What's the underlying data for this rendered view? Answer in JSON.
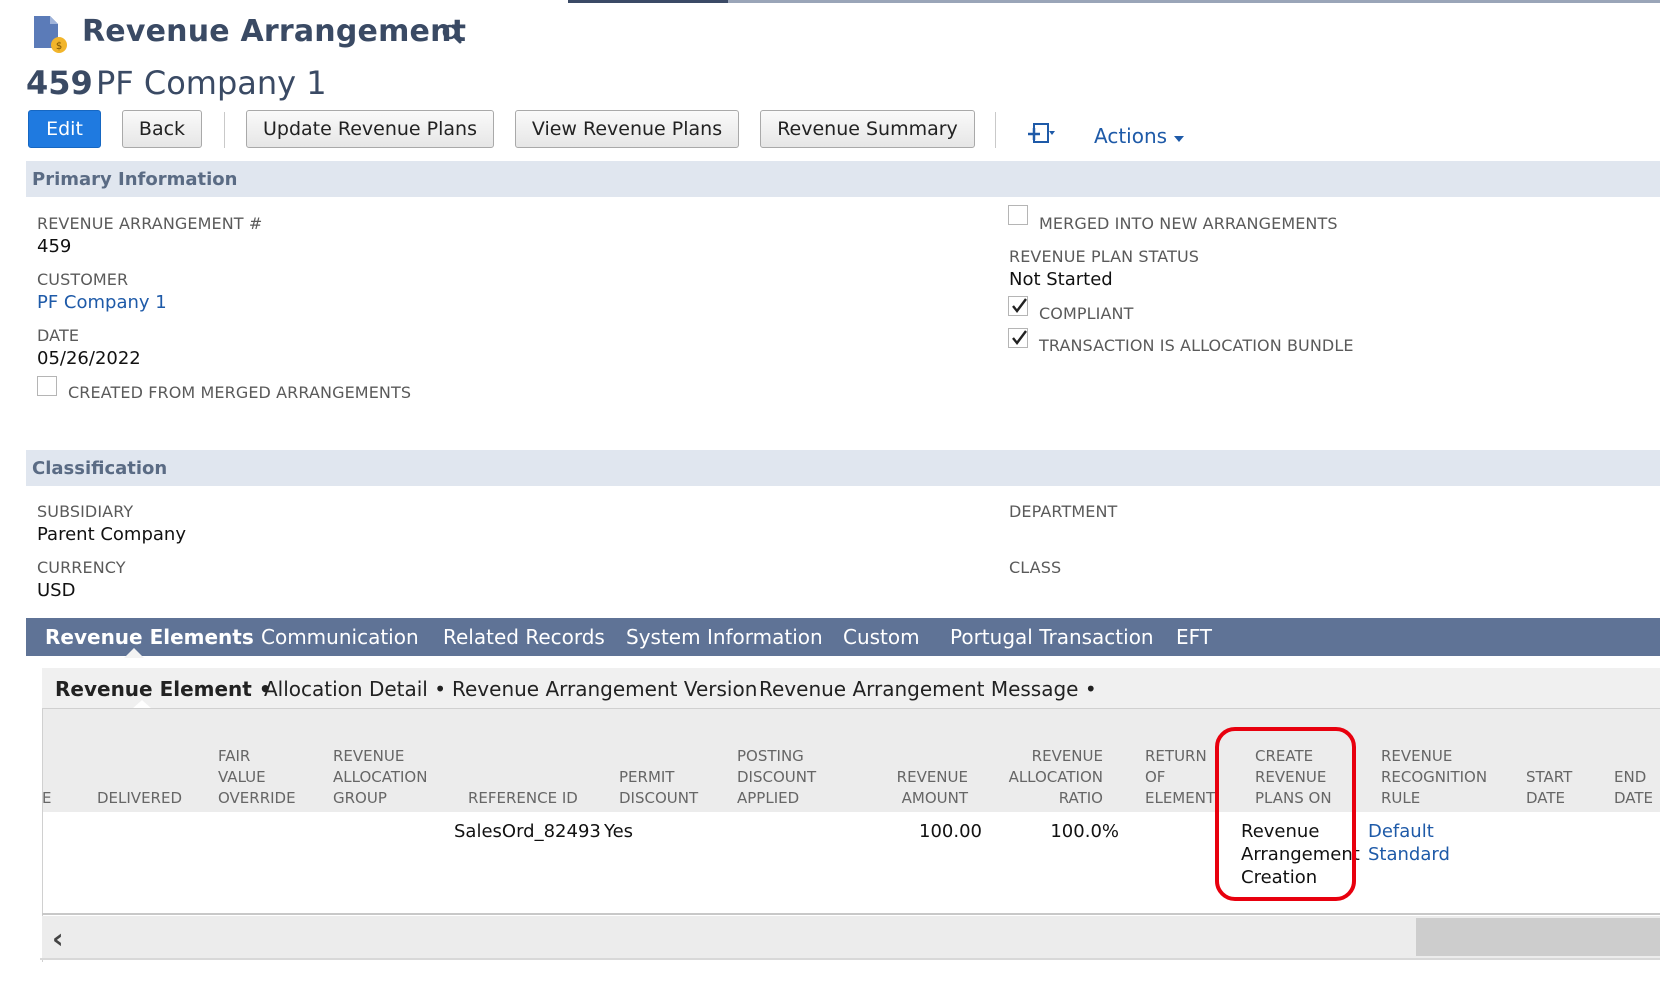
{
  "header": {
    "title": "Revenue Arrangement",
    "record_id": "459",
    "record_name": "PF Company 1"
  },
  "toolbar": {
    "edit_label": "Edit",
    "back_label": "Back",
    "update_plans_label": "Update Revenue Plans",
    "view_plans_label": "View Revenue Plans",
    "summary_label": "Revenue Summary",
    "actions_label": "Actions"
  },
  "primary": {
    "section_title": "Primary Information",
    "arrangement_no_label": "Revenue Arrangement #",
    "arrangement_no_value": "459",
    "customer_label": "Customer",
    "customer_value": "PF Company 1",
    "date_label": "Date",
    "date_value": "05/26/2022",
    "created_from_merged_label": "Created From Merged Arrangements",
    "created_from_merged_checked": false,
    "merged_into_new_label": "Merged Into New Arrangements",
    "merged_into_new_checked": false,
    "plan_status_label": "Revenue Plan Status",
    "plan_status_value": "Not Started",
    "compliant_label": "Compliant",
    "compliant_checked": true,
    "allocation_bundle_label": "Transaction Is Allocation Bundle",
    "allocation_bundle_checked": true
  },
  "classification": {
    "section_title": "Classification",
    "subsidiary_label": "Subsidiary",
    "subsidiary_value": "Parent Company",
    "currency_label": "Currency",
    "currency_value": "USD",
    "department_label": "Department",
    "class_label": "Class"
  },
  "tabs": [
    {
      "label": "Revenue Elements",
      "active": true
    },
    {
      "label": "Communication"
    },
    {
      "label": "Related Records"
    },
    {
      "label": "System Information"
    },
    {
      "label": "Custom"
    },
    {
      "label": "Portugal Transaction"
    },
    {
      "label": "EFT"
    }
  ],
  "subtabs": [
    {
      "label": "Revenue Element •",
      "active": true
    },
    {
      "label": "Allocation Detail •"
    },
    {
      "label": "Revenue Arrangement Version"
    },
    {
      "label": "Revenue Arrangement Message •"
    }
  ],
  "grid": {
    "columns": [
      {
        "l1": "",
        "l2": "",
        "l3": "E"
      },
      {
        "l1": "",
        "l2": "",
        "l3": "Delivered"
      },
      {
        "l1": "Fair",
        "l2": "Value",
        "l3": "Override"
      },
      {
        "l1": "Revenue",
        "l2": "Allocation",
        "l3": "Group"
      },
      {
        "l1": "",
        "l2": "",
        "l3": "Reference ID"
      },
      {
        "l1": "",
        "l2": "Permit",
        "l3": "Discount"
      },
      {
        "l1": "Posting",
        "l2": "Discount",
        "l3": "Applied"
      },
      {
        "l1": "",
        "l2": "Revenue",
        "l3": "Amount"
      },
      {
        "l1": "Revenue",
        "l2": "Allocation",
        "l3": "Ratio"
      },
      {
        "l1": "Return",
        "l2": "Of",
        "l3": "Element"
      },
      {
        "l1": "Create",
        "l2": "Revenue",
        "l3": "Plans On"
      },
      {
        "l1": "Revenue",
        "l2": "Recognition",
        "l3": "Rule"
      },
      {
        "l1": "",
        "l2": "Start",
        "l3": "Date"
      },
      {
        "l1": "",
        "l2": "End",
        "l3": "Date"
      }
    ],
    "row": {
      "reference_id": "SalesOrd_82493",
      "permit_discount": "Yes",
      "revenue_amount": "100.00",
      "allocation_ratio": "100.0%",
      "create_plans_on_1": "Revenue",
      "create_plans_on_2": "Arrangement",
      "create_plans_on_3": "Creation",
      "recognition_rule_1": "Default",
      "recognition_rule_2": "Standard"
    }
  },
  "colors": {
    "title": "#3a4a64",
    "primary_button": "#1f7ae0",
    "link": "#1e5aa8",
    "tab_bar": "#5f7396",
    "section_bar": "#e0e6ef",
    "highlight": "#e8000e"
  },
  "icons": [
    "revenue-arrangement-icon",
    "search-icon",
    "new-record-icon",
    "chevron-down-icon",
    "checkmark-icon",
    "scroll-left-icon"
  ]
}
